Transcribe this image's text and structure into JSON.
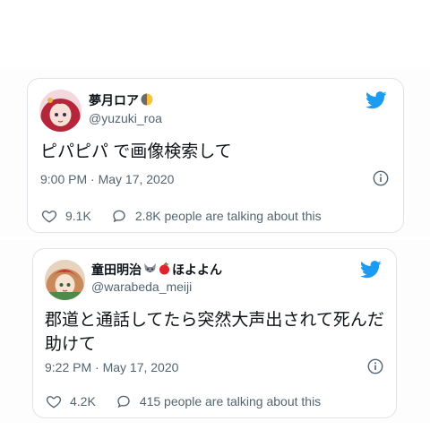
{
  "tweets": [
    {
      "display_name": "夢月ロア",
      "name_emoji": "moon-emoji",
      "handle": "@yuzuki_roa",
      "text": "ピパピパ で画像検索して",
      "timestamp": "9:00 PM · May 17, 2020",
      "likes": "9.1K",
      "talking": "2.8K people are talking about this",
      "avatar_hair_color": "#b5263a"
    },
    {
      "display_name": "童田明治",
      "name_suffix": "ほよよん",
      "name_emojis": [
        "wolf-emoji",
        "apple-emoji"
      ],
      "handle": "@warabeda_meiji",
      "text": "郡道と通話してたら突然大声出されて死んだ助けて",
      "timestamp": "9:22 PM · May 17, 2020",
      "likes": "4.2K",
      "talking": "415 people are talking about this",
      "avatar_hair_color": "#c88a5a"
    }
  ],
  "colors": {
    "twitter_blue": "#1d9bf0",
    "text_primary": "#0f1419",
    "text_secondary": "#536471",
    "border": "#dfe3e7"
  }
}
